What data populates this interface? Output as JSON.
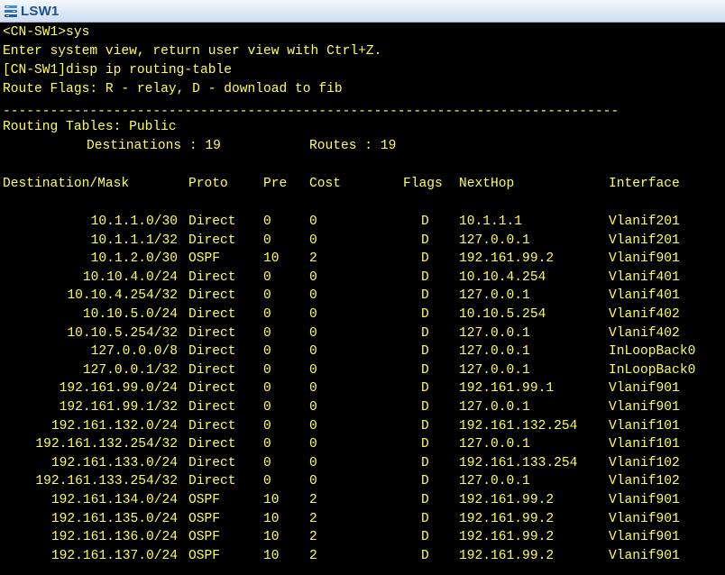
{
  "window": {
    "title": "LSW1",
    "icon": "switch-icon"
  },
  "terminal": {
    "colors": {
      "background": "#000000",
      "text": "#ffff57"
    },
    "lines": [
      "<CN-SW1>sys",
      "Enter system view, return user view with Ctrl+Z.",
      "[CN-SW1]disp ip routing-table",
      "Route Flags: R - relay, D - download to fib"
    ],
    "divider": "------------------------------------------------------------------------------",
    "summary": {
      "title": "Routing Tables: Public",
      "destinations": "Destinations : 19",
      "routes": "Routes : 19"
    },
    "headers": {
      "dest": "Destination/Mask",
      "proto": "Proto",
      "pre": "Pre",
      "cost": "Cost",
      "flags": "Flags",
      "nexthop": "NextHop",
      "iface": "Interface"
    },
    "routes": [
      {
        "dest": "10.1.1.0/30",
        "proto": "Direct",
        "pre": "0",
        "cost": "0",
        "flags": "D",
        "nexthop": "10.1.1.1",
        "iface": "Vlanif201"
      },
      {
        "dest": "10.1.1.1/32",
        "proto": "Direct",
        "pre": "0",
        "cost": "0",
        "flags": "D",
        "nexthop": "127.0.0.1",
        "iface": "Vlanif201"
      },
      {
        "dest": "10.1.2.0/30",
        "proto": "OSPF",
        "pre": "10",
        "cost": "2",
        "flags": "D",
        "nexthop": "192.161.99.2",
        "iface": "Vlanif901"
      },
      {
        "dest": "10.10.4.0/24",
        "proto": "Direct",
        "pre": "0",
        "cost": "0",
        "flags": "D",
        "nexthop": "10.10.4.254",
        "iface": "Vlanif401"
      },
      {
        "dest": "10.10.4.254/32",
        "proto": "Direct",
        "pre": "0",
        "cost": "0",
        "flags": "D",
        "nexthop": "127.0.0.1",
        "iface": "Vlanif401"
      },
      {
        "dest": "10.10.5.0/24",
        "proto": "Direct",
        "pre": "0",
        "cost": "0",
        "flags": "D",
        "nexthop": "10.10.5.254",
        "iface": "Vlanif402"
      },
      {
        "dest": "10.10.5.254/32",
        "proto": "Direct",
        "pre": "0",
        "cost": "0",
        "flags": "D",
        "nexthop": "127.0.0.1",
        "iface": "Vlanif402"
      },
      {
        "dest": "127.0.0.0/8",
        "proto": "Direct",
        "pre": "0",
        "cost": "0",
        "flags": "D",
        "nexthop": "127.0.0.1",
        "iface": "InLoopBack0"
      },
      {
        "dest": "127.0.0.1/32",
        "proto": "Direct",
        "pre": "0",
        "cost": "0",
        "flags": "D",
        "nexthop": "127.0.0.1",
        "iface": "InLoopBack0"
      },
      {
        "dest": "192.161.99.0/24",
        "proto": "Direct",
        "pre": "0",
        "cost": "0",
        "flags": "D",
        "nexthop": "192.161.99.1",
        "iface": "Vlanif901"
      },
      {
        "dest": "192.161.99.1/32",
        "proto": "Direct",
        "pre": "0",
        "cost": "0",
        "flags": "D",
        "nexthop": "127.0.0.1",
        "iface": "Vlanif901"
      },
      {
        "dest": "192.161.132.0/24",
        "proto": "Direct",
        "pre": "0",
        "cost": "0",
        "flags": "D",
        "nexthop": "192.161.132.254",
        "iface": "Vlanif101"
      },
      {
        "dest": "192.161.132.254/32",
        "proto": "Direct",
        "pre": "0",
        "cost": "0",
        "flags": "D",
        "nexthop": "127.0.0.1",
        "iface": "Vlanif101"
      },
      {
        "dest": "192.161.133.0/24",
        "proto": "Direct",
        "pre": "0",
        "cost": "0",
        "flags": "D",
        "nexthop": "192.161.133.254",
        "iface": "Vlanif102"
      },
      {
        "dest": "192.161.133.254/32",
        "proto": "Direct",
        "pre": "0",
        "cost": "0",
        "flags": "D",
        "nexthop": "127.0.0.1",
        "iface": "Vlanif102"
      },
      {
        "dest": "192.161.134.0/24",
        "proto": "OSPF",
        "pre": "10",
        "cost": "2",
        "flags": "D",
        "nexthop": "192.161.99.2",
        "iface": "Vlanif901"
      },
      {
        "dest": "192.161.135.0/24",
        "proto": "OSPF",
        "pre": "10",
        "cost": "2",
        "flags": "D",
        "nexthop": "192.161.99.2",
        "iface": "Vlanif901"
      },
      {
        "dest": "192.161.136.0/24",
        "proto": "OSPF",
        "pre": "10",
        "cost": "2",
        "flags": "D",
        "nexthop": "192.161.99.2",
        "iface": "Vlanif901"
      },
      {
        "dest": "192.161.137.0/24",
        "proto": "OSPF",
        "pre": "10",
        "cost": "2",
        "flags": "D",
        "nexthop": "192.161.99.2",
        "iface": "Vlanif901"
      }
    ]
  }
}
